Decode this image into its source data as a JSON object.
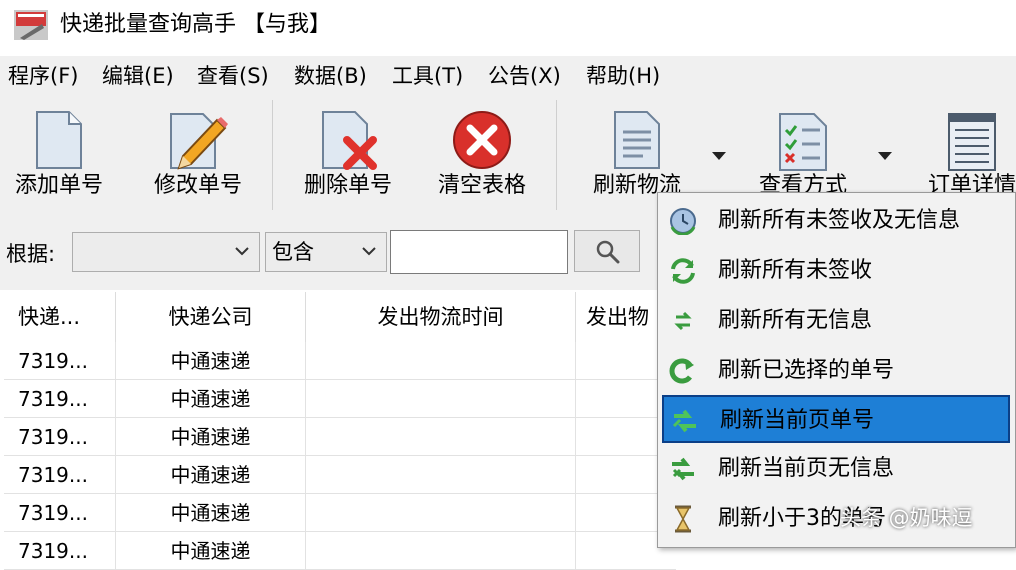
{
  "window": {
    "title": "快递批量查询高手 【与我】"
  },
  "menu": [
    "程序(F)",
    "编辑(E)",
    "查看(S)",
    "数据(B)",
    "工具(T)",
    "公告(X)",
    "帮助(H)"
  ],
  "toolbar": {
    "add": "添加单号",
    "edit": "修改单号",
    "delete": "删除单号",
    "clear": "清空表格",
    "refresh": "刷新物流",
    "view": "查看方式",
    "order_details": "订单详情"
  },
  "filter": {
    "label": "根据:",
    "field_value": "",
    "match_value": "包含",
    "query": ""
  },
  "table": {
    "columns": [
      "快递...",
      "快递公司",
      "发出物流时间",
      "发出物"
    ],
    "rows": [
      [
        "7319...",
        "中通速递"
      ],
      [
        "7319...",
        "中通速递"
      ],
      [
        "7319...",
        "中通速递"
      ],
      [
        "7319...",
        "中通速递"
      ],
      [
        "7319...",
        "中通速递"
      ],
      [
        "7319...",
        "中通速递"
      ]
    ]
  },
  "refresh_menu": {
    "items": [
      {
        "label": "刷新所有未签收及无信息",
        "icon": "refresh-clock-icon"
      },
      {
        "label": "刷新所有未签收",
        "icon": "refresh-arrows-icon"
      },
      {
        "label": "刷新所有无信息",
        "icon": "refresh-small-icon"
      },
      {
        "label": "刷新已选择的单号",
        "icon": "refresh-selected-icon"
      },
      {
        "label": "刷新当前页单号",
        "icon": "refresh-page-icon",
        "selected": true
      },
      {
        "label": "刷新当前页无信息",
        "icon": "refresh-page-noinfo-icon"
      },
      {
        "label": "刷新小于3的单号",
        "icon": "hourglass-icon"
      }
    ]
  },
  "watermark": "头条 @奶味逗",
  "colors": {
    "selection": "#1e7fd6",
    "selection_border": "#0b3f87",
    "chrome": "#f0f0f0",
    "delete_red": "#e0322c"
  }
}
